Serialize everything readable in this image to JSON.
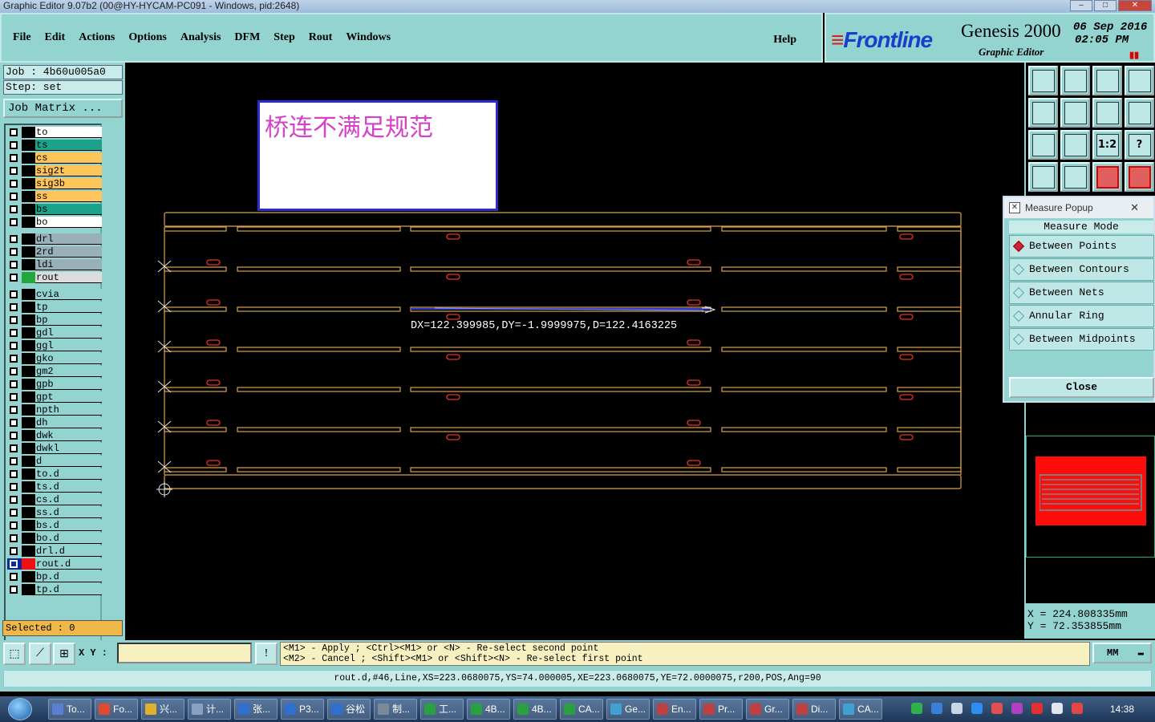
{
  "window": {
    "title": "Graphic Editor 9.07b2 (00@HY-HYCAM-PC091 - Windows, pid:2648)"
  },
  "menu": [
    "File",
    "Edit",
    "Actions",
    "Options",
    "Analysis",
    "DFM",
    "Step",
    "Rout",
    "Windows"
  ],
  "help_label": "Help",
  "brand": {
    "logo": "Frontline",
    "product": "Genesis 2000",
    "subtitle": "Graphic Editor",
    "date": "06 Sep 2016",
    "time": "02:05 PM"
  },
  "job": {
    "job_line": "Job : 4b60u005a0",
    "step_line": "Step: set",
    "matrix_button": "Job Matrix ..."
  },
  "layers": [
    {
      "name": "to",
      "color": "#ffffff",
      "group": 0
    },
    {
      "name": "ts",
      "color": "#1aa28a",
      "group": 0
    },
    {
      "name": "cs",
      "color": "#ffc45a",
      "group": 0
    },
    {
      "name": "sig2t",
      "color": "#ffc45a",
      "group": 0
    },
    {
      "name": "sig3b",
      "color": "#ffc45a",
      "group": 0
    },
    {
      "name": "ss",
      "color": "#ffc45a",
      "group": 0
    },
    {
      "name": "bs",
      "color": "#1aa28a",
      "group": 0
    },
    {
      "name": "bo",
      "color": "#ffffff",
      "group": 0
    },
    {
      "name": "drl",
      "color": "#9ab0b8",
      "group": 1
    },
    {
      "name": "2rd",
      "color": "#9ab0b8",
      "group": 1
    },
    {
      "name": "ldi",
      "color": "#9ab0b8",
      "group": 1
    },
    {
      "name": "rout",
      "color": "#dcdcdc",
      "group": 1
    },
    {
      "name": "cvia",
      "color": "#93d3d0",
      "group": 2
    },
    {
      "name": "tp",
      "color": "#93d3d0",
      "group": 2
    },
    {
      "name": "bp",
      "color": "#93d3d0",
      "group": 2
    },
    {
      "name": "gdl",
      "color": "#93d3d0",
      "group": 2
    },
    {
      "name": "ggl",
      "color": "#93d3d0",
      "group": 2
    },
    {
      "name": "gko",
      "color": "#93d3d0",
      "group": 2
    },
    {
      "name": "gm2",
      "color": "#93d3d0",
      "group": 2
    },
    {
      "name": "gpb",
      "color": "#93d3d0",
      "group": 2
    },
    {
      "name": "gpt",
      "color": "#93d3d0",
      "group": 2
    },
    {
      "name": "npth",
      "color": "#93d3d0",
      "group": 2
    },
    {
      "name": "dh",
      "color": "#93d3d0",
      "group": 2
    },
    {
      "name": "dwk",
      "color": "#93d3d0",
      "group": 2
    },
    {
      "name": "dwkl",
      "color": "#93d3d0",
      "group": 2
    },
    {
      "name": "d",
      "color": "#93d3d0",
      "group": 2
    },
    {
      "name": "to.d",
      "color": "#93d3d0",
      "group": 2
    },
    {
      "name": "ts.d",
      "color": "#93d3d0",
      "group": 2
    },
    {
      "name": "cs.d",
      "color": "#93d3d0",
      "group": 2
    },
    {
      "name": "ss.d",
      "color": "#93d3d0",
      "group": 2
    },
    {
      "name": "bs.d",
      "color": "#93d3d0",
      "group": 2
    },
    {
      "name": "bo.d",
      "color": "#93d3d0",
      "group": 2
    },
    {
      "name": "drl.d",
      "color": "#93d3d0",
      "group": 2
    },
    {
      "name": "rout.d",
      "color": "#93d3d0",
      "group": 2,
      "active": true
    },
    {
      "name": "bp.d",
      "color": "#93d3d0",
      "group": 2
    },
    {
      "name": "tp.d",
      "color": "#93d3d0",
      "group": 2
    }
  ],
  "selected_label": "Selected : 0",
  "canvas": {
    "note_text": "桥连不满足规范",
    "measure_readout": "DX=122.399985,DY=-1.9999975,D=122.4163225"
  },
  "toolbar_icons": [
    "zoom-home-icon",
    "zoom-back-icon",
    "home-icon",
    "window-icon",
    "pan-left-icon",
    "pan-right-icon",
    "undo-icon",
    "redraw-icon",
    "fit-icon",
    "center-icon",
    "one-to-two-icon",
    "query-icon",
    "wrench-icon",
    "measure-tool-icon",
    "snap-icon",
    "display-icon"
  ],
  "toolbar_texts": [
    "",
    "",
    "",
    "",
    "",
    "",
    "",
    "",
    "",
    "",
    "1:2",
    "?",
    "",
    "",
    "",
    ""
  ],
  "measure_popup": {
    "title": "Measure Popup",
    "mode_label": "Measure Mode",
    "options": [
      {
        "label": "Between Points",
        "selected": true
      },
      {
        "label": "Between Contours",
        "selected": false
      },
      {
        "label": "Between Nets",
        "selected": false
      },
      {
        "label": "Annular Ring",
        "selected": false
      },
      {
        "label": "Between Midpoints",
        "selected": false
      }
    ],
    "close_label": "Close"
  },
  "coords": {
    "x": "X = 224.808335mm",
    "y": "Y = 72.353855mm"
  },
  "bottom": {
    "xy_label": "X Y :",
    "xy_value": "",
    "hint_line1": "<M1> - Apply  ; <Ctrl><M1> or <N> - Re-select second point",
    "hint_line2": "<M2> - Cancel ; <Shift><M1> or <Shift><N> - Re-select first point",
    "units": "MM",
    "status": "rout.d,#46,Line,XS=223.0680075,YS=74.000005,XE=223.0680075,YE=72.0000075,r200,POS,Ang=90"
  },
  "taskbar": {
    "items": [
      "To...",
      "Fo...",
      "兴...",
      "计...",
      "张...",
      "P3...",
      "谷松",
      "制...",
      "工...",
      "4B...",
      "4B...",
      "CA...",
      "Ge...",
      "En...",
      "Pr...",
      "Gr...",
      "Di...",
      "CA..."
    ],
    "clock": "14:38"
  },
  "colors": {
    "panel": "#93d3d0",
    "board_outline": "#d9a24a",
    "slot": "#e8302a",
    "measure_line": "#2b3bd6"
  }
}
